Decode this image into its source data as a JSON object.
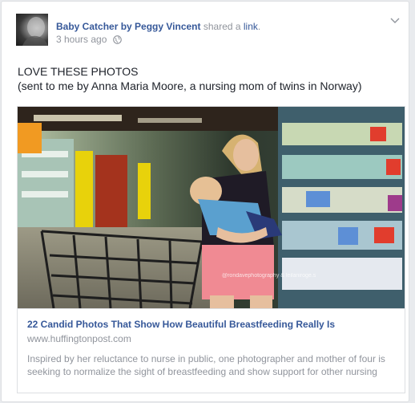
{
  "post": {
    "author": "Baby Catcher by Peggy Vincent",
    "action_text": " shared a ",
    "action_link": "link",
    "action_end": ".",
    "timestamp": "3 hours ago",
    "text_line1": "LOVE THESE PHOTOS",
    "text_line2": "(sent to me by Anna Maria Moore, a nursing mom of twins in Norway)"
  },
  "link_preview": {
    "title": "22 Candid Photos That Show How Beautiful Breastfeeding Really Is",
    "domain": "www.huffingtonpost.com",
    "description": "Inspired by her reluctance to nurse in public, one photographer and mother of four is seeking to normalize the sight of breastfeeding and show support for other nursing moms. Leilani Rogers is a Texas-based photographer who has launched an initia..."
  },
  "icons": {
    "privacy": "globe-icon",
    "menu": "chevron-down-icon"
  },
  "colors": {
    "link_blue": "#365899",
    "meta_gray": "#90949c",
    "text": "#1d2129"
  }
}
